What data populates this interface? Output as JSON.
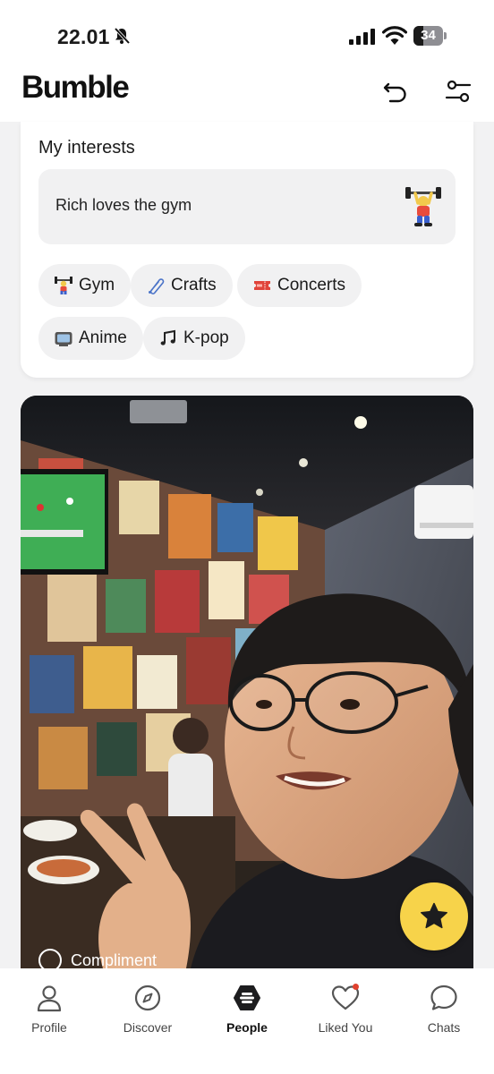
{
  "status_bar": {
    "time": "22.01",
    "battery": "34",
    "battery_level": 0.34
  },
  "header": {
    "logo": "Bumble"
  },
  "interests": {
    "title": "My interests",
    "prompt": "Rich loves the gym",
    "chips": [
      {
        "label": "Gym",
        "icon": "weightlifter-icon"
      },
      {
        "label": "Crafts",
        "icon": "safety-pin-icon"
      },
      {
        "label": "Concerts",
        "icon": "ticket-icon"
      },
      {
        "label": "Anime",
        "icon": "tv-icon"
      },
      {
        "label": "K-pop",
        "icon": "music-note-icon"
      }
    ]
  },
  "photo": {
    "compliment_label": "Compliment"
  },
  "nav": {
    "items": [
      {
        "label": "Profile",
        "icon": "person-icon"
      },
      {
        "label": "Discover",
        "icon": "compass-icon"
      },
      {
        "label": "People",
        "icon": "bumble-logo-icon",
        "active": true
      },
      {
        "label": "Liked You",
        "icon": "heart-icon",
        "badge": true
      },
      {
        "label": "Chats",
        "icon": "chat-bubble-icon"
      }
    ]
  },
  "colors": {
    "accent": "#f7d34a",
    "badge": "#e0412e",
    "chip_bg": "#f1f1f2"
  }
}
